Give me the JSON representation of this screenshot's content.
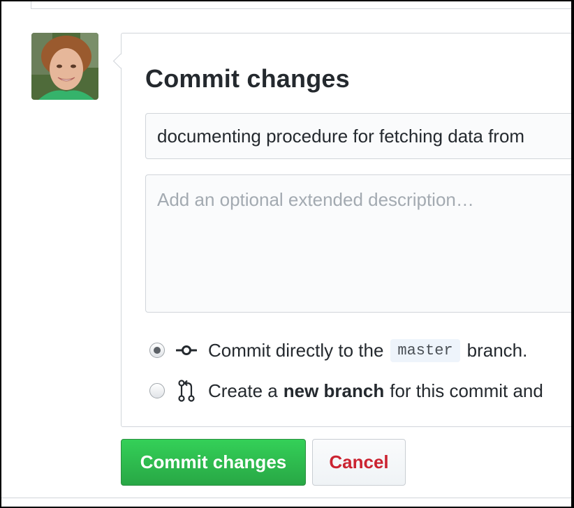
{
  "commit_form": {
    "heading": "Commit changes",
    "summary_value": "documenting procedure for fetching data from",
    "description_placeholder": "Add an optional extended description…",
    "options": {
      "direct": {
        "prefix": "Commit directly to the",
        "branch": "master",
        "suffix": "branch.",
        "selected": true,
        "icon": "git-commit-icon"
      },
      "new_branch": {
        "prefix": "Create a",
        "bold": "new branch",
        "suffix": "for this commit and",
        "selected": false,
        "icon": "git-pull-request-icon"
      }
    },
    "buttons": {
      "commit": "Commit changes",
      "cancel": "Cancel"
    }
  },
  "colors": {
    "commit_button": "#28a745",
    "cancel_text": "#cb2431",
    "border": "#d1d5da"
  },
  "icons": {
    "avatar": "user-avatar-photo"
  }
}
